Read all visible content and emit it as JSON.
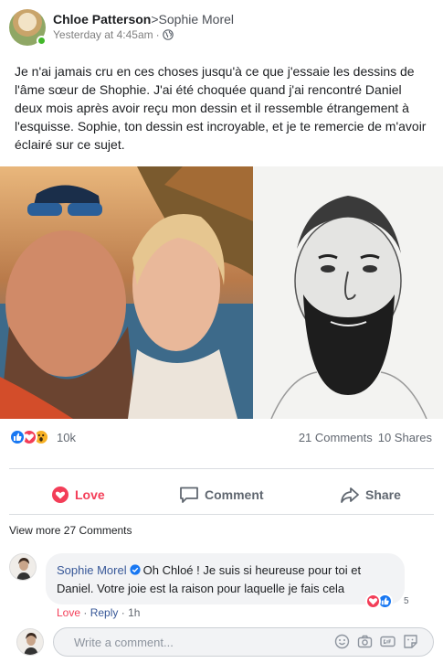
{
  "post": {
    "author": "Chloe Patterson",
    "recipient": ">Sophie Morel",
    "timestamp": "Yesterday at 4:45am",
    "separator": "·",
    "privacy_icon": "globe-icon",
    "text": "Je n'ai jamais cru en ces choses jusqu'à ce que j'essaie les dessins de l'âme sœur de Shophie. J'ai été choquée quand j'ai rencontré Daniel deux mois après avoir reçu mon dessin et il ressemble étrangement à l'esquisse. Sophie, ton dessin est incroyable, et je te remercie de m'avoir éclairé sur ce sujet."
  },
  "stats": {
    "reaction_icons": [
      "like-icon",
      "love-icon",
      "wow-icon"
    ],
    "reaction_count": "10k",
    "comments": "21 Comments",
    "shares": "10 Shares"
  },
  "actions": {
    "love": "Love",
    "comment": "Comment",
    "share": "Share"
  },
  "comments": {
    "view_more": "View more 27 Comments",
    "items": [
      {
        "author": "Sophie Morel",
        "verified_icon": "verified-badge-icon",
        "text": "Oh Chloé ! Je suis si heureuse pour toi et Daniel. Votre joie est la raison pour laquelle je fais cela",
        "love": "Love",
        "dot": "·",
        "reply": "Reply",
        "time": "1h",
        "reaction_count": "5"
      }
    ]
  },
  "composer": {
    "placeholder": "Write a comment...",
    "icons": [
      "emoji-icon",
      "camera-icon",
      "gif-icon",
      "sticker-icon"
    ]
  },
  "colors": {
    "brand_blue": "#1877f2",
    "link_blue": "#385898",
    "love_red": "#f33e58",
    "online_green": "#42b72a"
  }
}
